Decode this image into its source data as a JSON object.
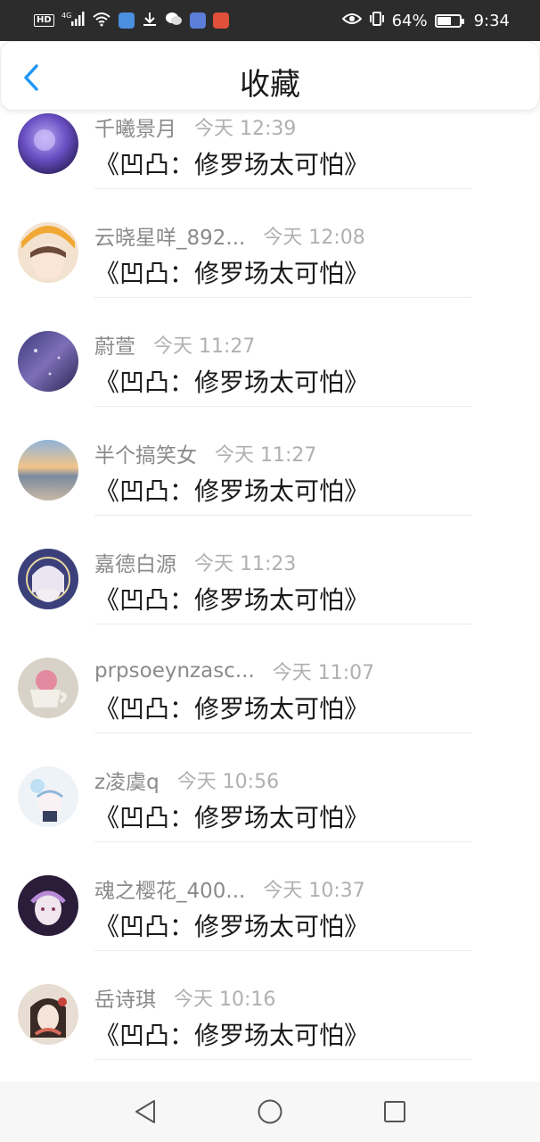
{
  "status_bar": {
    "hd_label": "HD",
    "network_label": "4G",
    "battery_percent_text": "64%",
    "battery_level": 0.64,
    "time": "9:34"
  },
  "header": {
    "title": "收藏",
    "back_icon": "chevron-left-icon",
    "accent_color": "#2196f3"
  },
  "items": [
    {
      "username": "千曦景月",
      "time": "今天 12:39",
      "content": "《凹凸：修罗场太可怕》"
    },
    {
      "username": "云晓星咩_892...",
      "time": "今天 12:08",
      "content": "《凹凸：修罗场太可怕》"
    },
    {
      "username": "蔚萱",
      "time": "今天 11:27",
      "content": "《凹凸：修罗场太可怕》"
    },
    {
      "username": "半个搞笑女",
      "time": "今天 11:27",
      "content": "《凹凸：修罗场太可怕》"
    },
    {
      "username": "嘉德白源",
      "time": "今天 11:23",
      "content": "《凹凸：修罗场太可怕》"
    },
    {
      "username": "prpsoeynzasc...",
      "time": "今天 11:07",
      "content": "《凹凸：修罗场太可怕》"
    },
    {
      "username": "z凌虞q",
      "time": "今天 10:56",
      "content": "《凹凸：修罗场太可怕》"
    },
    {
      "username": "魂之樱花_400...",
      "time": "今天 10:37",
      "content": "《凹凸：修罗场太可怕》"
    },
    {
      "username": "岳诗琪",
      "time": "今天 10:16",
      "content": "《凹凸：修罗场太可怕》"
    }
  ],
  "nav_bar": {
    "back_icon": "triangle-back-icon",
    "home_icon": "circle-home-icon",
    "recents_icon": "square-recents-icon"
  }
}
